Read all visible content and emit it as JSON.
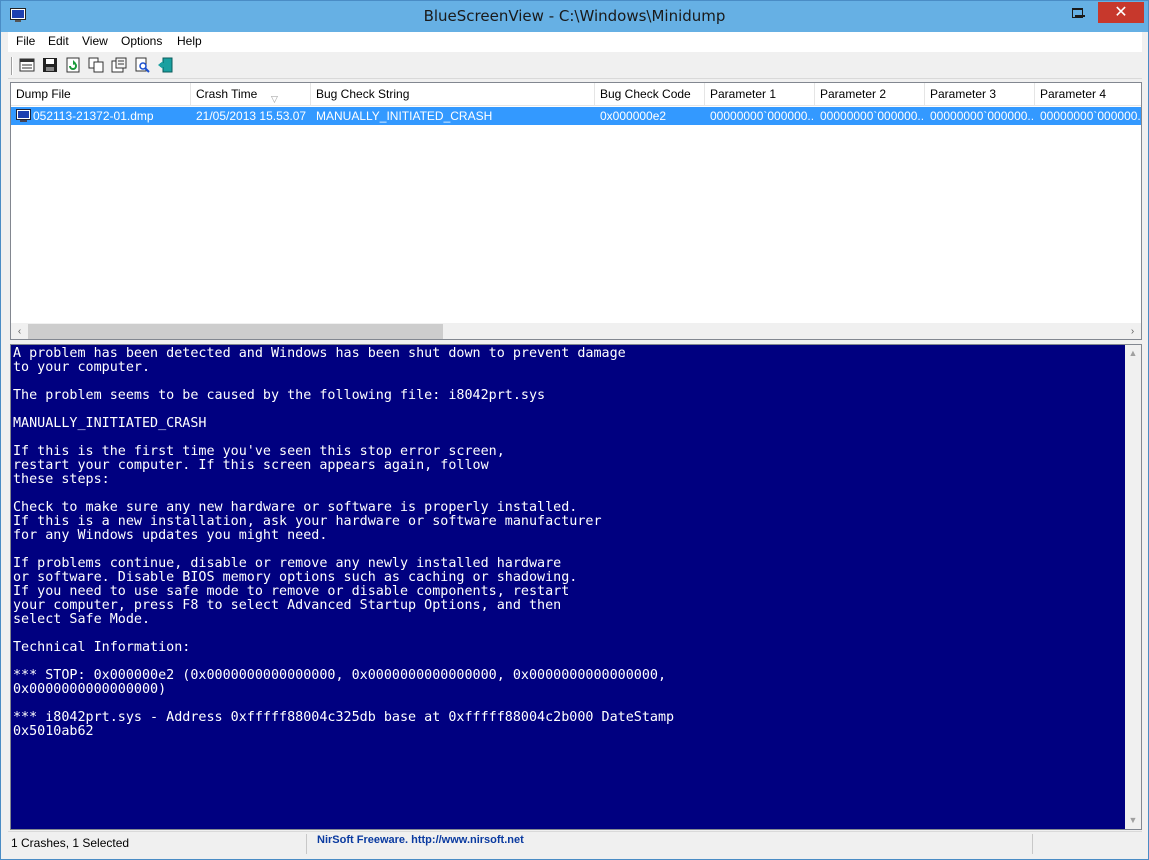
{
  "window": {
    "title": "BlueScreenView  -  C:\\Windows\\Minidump",
    "close_glyph": "✕"
  },
  "menu": {
    "items": [
      "File",
      "Edit",
      "View",
      "Options",
      "Help"
    ]
  },
  "toolbar": {
    "buttons": [
      "properties-icon",
      "save-icon",
      "refresh-icon",
      "copy-icon",
      "html-report-icon",
      "find-icon",
      "exit-icon"
    ]
  },
  "list": {
    "columns": [
      "Dump File",
      "Crash Time",
      "Bug Check String",
      "Bug Check Code",
      "Parameter 1",
      "Parameter 2",
      "Parameter 3",
      "Parameter 4"
    ],
    "sort_indicator": "▽",
    "rows": [
      {
        "dump_file": "052113-21372-01.dmp",
        "crash_time": "21/05/2013 15.53.07",
        "bug_check_string": "MANUALLY_INITIATED_CRASH",
        "bug_check_code": "0x000000e2",
        "param1": "00000000`000000...",
        "param2": "00000000`000000...",
        "param3": "00000000`000000...",
        "param4": "00000000`000000..."
      }
    ],
    "scroll_left": "‹",
    "scroll_right": "›"
  },
  "bsod": {
    "text": "A problem has been detected and Windows has been shut down to prevent damage\nto your computer.\n\nThe problem seems to be caused by the following file: i8042prt.sys\n\nMANUALLY_INITIATED_CRASH\n\nIf this is the first time you've seen this stop error screen,\nrestart your computer. If this screen appears again, follow\nthese steps:\n\nCheck to make sure any new hardware or software is properly installed.\nIf this is a new installation, ask your hardware or software manufacturer\nfor any Windows updates you might need.\n\nIf problems continue, disable or remove any newly installed hardware\nor software. Disable BIOS memory options such as caching or shadowing.\nIf you need to use safe mode to remove or disable components, restart\nyour computer, press F8 to select Advanced Startup Options, and then\nselect Safe Mode.\n\nTechnical Information:\n\n*** STOP: 0x000000e2 (0x0000000000000000, 0x0000000000000000, 0x0000000000000000,\n0x0000000000000000)\n\n*** i8042prt.sys - Address 0xfffff88004c325db base at 0xfffff88004c2b000 DateStamp\n0x5010ab62",
    "scroll_up": "▲",
    "scroll_down": "▼"
  },
  "status": {
    "count_text": "1 Crashes, 1 Selected",
    "credit_text": "NirSoft Freeware.  http://www.nirsoft.net"
  },
  "colors": {
    "bsod_background": "#000080",
    "selection": "#3399ff",
    "titlebar": "#66b0e4",
    "close_button": "#c7382c"
  }
}
